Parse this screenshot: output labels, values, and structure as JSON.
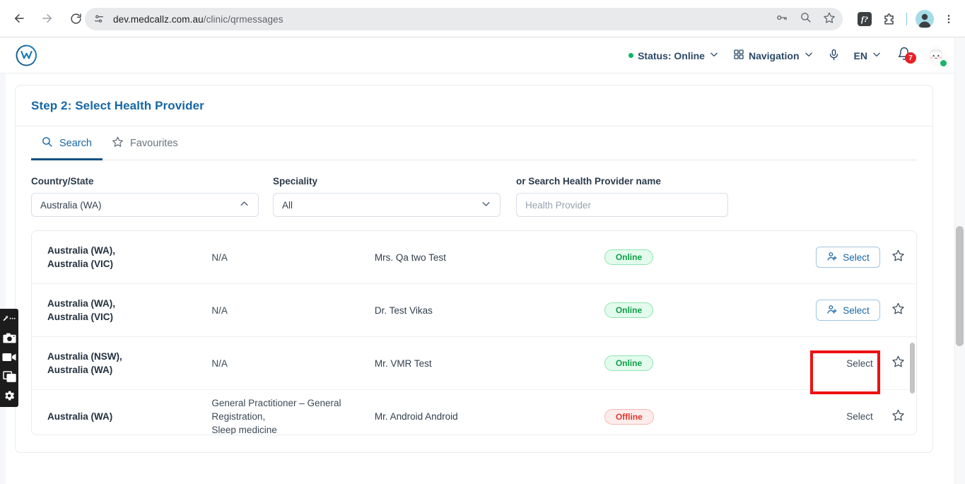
{
  "browser": {
    "back_label": "Back",
    "forward_label": "Forward",
    "reload_label": "Reload",
    "url_host": "dev.medcallz.com.au",
    "url_path": "/clinic/qrmessages",
    "extension_badge": "f?"
  },
  "header": {
    "status_label": "Status: Online",
    "navigation_label": "Navigation",
    "language_label": "EN",
    "notification_count": "7"
  },
  "card": {
    "title": "Step 2: Select Health Provider",
    "tabs": [
      {
        "label": "Search",
        "icon": "search-icon",
        "active": true
      },
      {
        "label": "Favourites",
        "icon": "star-icon",
        "active": false
      }
    ],
    "filters": {
      "country_label": "Country/State",
      "country_value": "Australia (WA)",
      "speciality_label": "Speciality",
      "speciality_value": "All",
      "search_label": "or Search Health Provider name",
      "search_value": "",
      "search_placeholder": "Health Provider"
    },
    "rows": [
      {
        "region": "Australia (WA),\nAustralia (VIC)",
        "speciality": "N/A",
        "name": "Mrs. Qa two Test",
        "status": "Online",
        "status_type": "online",
        "action_label": "Select",
        "action_style": "button"
      },
      {
        "region": "Australia (WA),\nAustralia (VIC)",
        "speciality": "N/A",
        "name": "Dr. Test Vikas",
        "status": "Online",
        "status_type": "online",
        "action_label": "Select",
        "action_style": "button"
      },
      {
        "region": "Australia (NSW),\nAustralia (WA)",
        "speciality": "N/A",
        "name": "Mr. VMR Test",
        "status": "Online",
        "status_type": "online",
        "action_label": "Select",
        "action_style": "text"
      },
      {
        "region": "Australia (WA)",
        "speciality": "General Practitioner – General Registration,\nSleep medicine",
        "name": "Mr. Android Android",
        "status": "Offline",
        "status_type": "offline",
        "action_label": "Select",
        "action_style": "text"
      }
    ]
  },
  "dock": {
    "items": [
      "pen-icon",
      "camera-icon",
      "video-icon",
      "window-icon",
      "gear-icon"
    ]
  },
  "colors": {
    "brand_blue": "#1667a5",
    "tab_underline": "#14517f",
    "online_green": "#0f9d48",
    "offline_red": "#e03a2f",
    "highlight_red": "#ee1111",
    "badge_red": "#ea2027"
  }
}
